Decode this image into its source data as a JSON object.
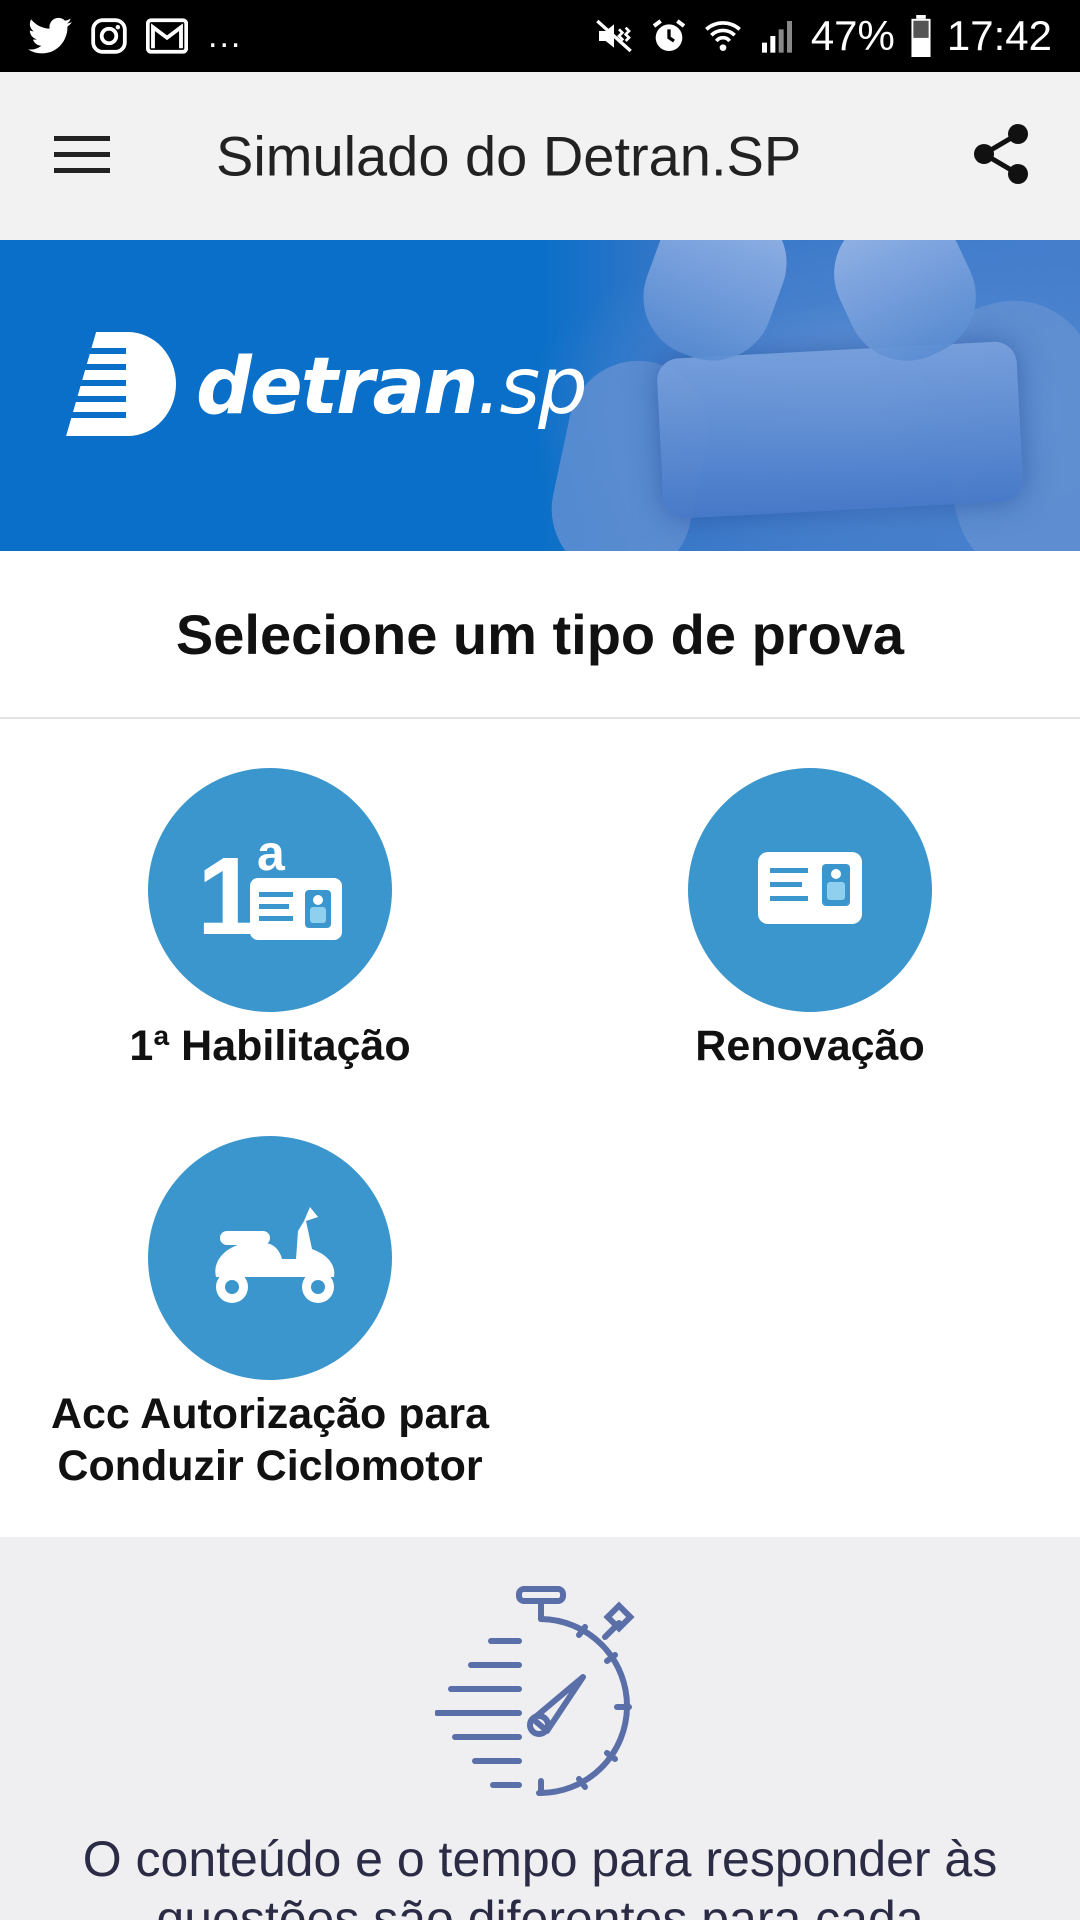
{
  "status_bar": {
    "left_icons": [
      "twitter-icon",
      "instagram-icon",
      "gmail-icon"
    ],
    "more": "...",
    "right_icons": [
      "mute-icon",
      "alarm-icon",
      "wifi-icon",
      "signal-icon",
      "battery-icon"
    ],
    "battery": "47%",
    "time": "17:42"
  },
  "app_bar": {
    "title": "Simulado do Detran.SP",
    "menu_icon": "hamburger-menu-icon",
    "share_icon": "share-icon"
  },
  "banner": {
    "brand_bold": "detran",
    "brand_light": ".sp"
  },
  "section": {
    "title": "Selecione um tipo de prova"
  },
  "options": [
    {
      "label": "1ª Habilitação",
      "icon": "first-license-icon",
      "badge": "1",
      "superscript": "a"
    },
    {
      "label": "Renovação",
      "icon": "license-card-icon"
    },
    {
      "label": "Acc Autorização para\nConduzir Ciclomotor",
      "icon": "scooter-icon"
    }
  ],
  "info": {
    "icon": "stopwatch-icon",
    "text": "O conteúdo e o tempo para responder às questões são diferentes para cada"
  },
  "colors": {
    "status_bar_bg": "#000000",
    "app_bar_bg": "#f2f2f2",
    "banner_blue": "#0a6fc8",
    "option_circle": "#3a96cc",
    "info_bg": "#efeff1",
    "info_text": "#2b2b45",
    "timer_icon": "#5a6ea8"
  }
}
